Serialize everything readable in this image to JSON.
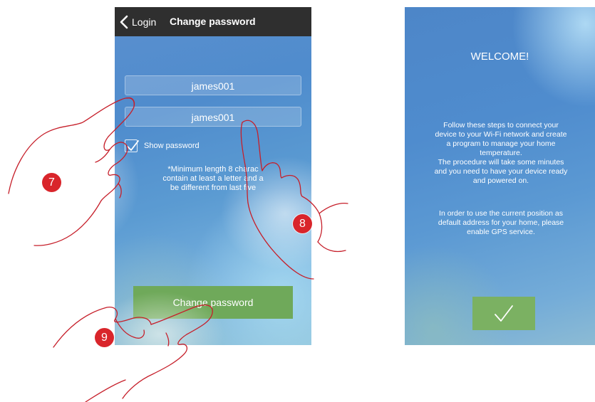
{
  "left_screen": {
    "back_label": "Login",
    "title": "Change password",
    "password_value": "james001",
    "confirm_value": "james001",
    "show_password_label": "Show password",
    "show_password_checked": true,
    "hint_lines": [
      "*Minimum length 8 charac",
      "contain at least a letter and a",
      "be different from last five"
    ],
    "button_label": "Change password",
    "button_color": "#6fa95a",
    "topbar_color": "#2f2f2f"
  },
  "right_screen": {
    "title": "WELCOME!",
    "intro_lines": [
      "Follow these steps to connect your",
      "device to your Wi-Fi network and create",
      "a program to manage your home",
      "temperature.",
      "The procedure will take some minutes",
      "and you need to have your device ready",
      "and powered on."
    ],
    "gps_lines": [
      "In order to use the current position as",
      "default address for your home, please",
      "enable GPS service."
    ],
    "confirm_icon": "checkmark-icon",
    "button_color": "#7bb162"
  },
  "steps": [
    "7",
    "8",
    "9"
  ],
  "badge_color": "#d9252b"
}
